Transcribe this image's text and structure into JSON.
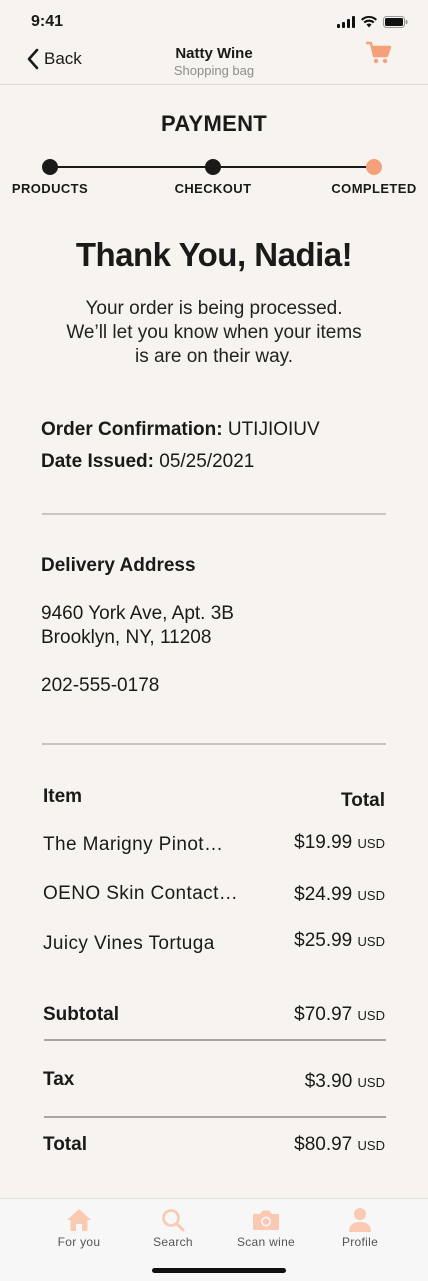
{
  "status_bar": {
    "time": "9:41"
  },
  "nav": {
    "back_label": "Back",
    "title": "Natty Wine",
    "subtitle": "Shopping bag"
  },
  "steps": {
    "heading": "PAYMENT",
    "items": [
      {
        "label": "PRODUCTS",
        "state": "done"
      },
      {
        "label": "CHECKOUT",
        "state": "done"
      },
      {
        "label": "COMPLETED",
        "state": "current"
      }
    ]
  },
  "confirmation": {
    "thanks": "Thank You, Nadia!",
    "message_lines": [
      "Your order is being processed.",
      "We’ll let you know when your items",
      "is are on their way."
    ],
    "order_label": "Order Confirmation:",
    "order_value": "UTIJIOIUV",
    "date_label": "Date Issued:",
    "date_value": "05/25/2021"
  },
  "delivery": {
    "heading": "Delivery Address",
    "address_lines": [
      "9460 York Ave, Apt. 3B",
      "Brooklyn, NY, 11208"
    ],
    "phone": "202-555-0178"
  },
  "order": {
    "item_header": "Item",
    "total_header": "Total",
    "currency": "USD",
    "items": [
      {
        "name": "The Marigny Pinot…",
        "price": "$19.99"
      },
      {
        "name": "OENO Skin Contact…",
        "price": "$24.99"
      },
      {
        "name": "Juicy Vines Tortuga",
        "price": "$25.99"
      }
    ],
    "subtotal_label": "Subtotal",
    "subtotal_value": "$70.97",
    "tax_label": "Tax",
    "tax_value": "$3.90",
    "total_label": "Total",
    "total_value": "$80.97"
  },
  "tabbar": {
    "tabs": [
      {
        "label": "For you",
        "icon": "home-icon"
      },
      {
        "label": "Search",
        "icon": "search-icon"
      },
      {
        "label": "Scan wine",
        "icon": "camera-icon"
      },
      {
        "label": "Profile",
        "icon": "profile-icon"
      }
    ]
  },
  "colors": {
    "accent": "#f5a07a",
    "background": "#f7f4f0",
    "text": "#1a1a1a",
    "muted": "#8d8d8d",
    "tab_icon": "#f9c9b1"
  }
}
